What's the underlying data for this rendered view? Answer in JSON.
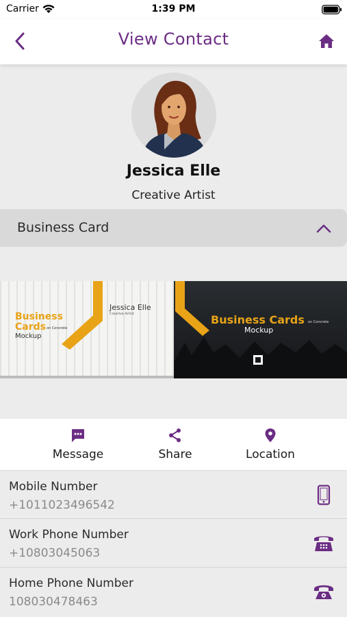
{
  "status_bar": {
    "carrier": "Carrier",
    "time": "1:39 PM"
  },
  "nav": {
    "title": "View Contact"
  },
  "contact": {
    "name": "Jessica Elle",
    "title": "Creative Artist"
  },
  "business_card_section": {
    "label": "Business Card",
    "expanded": true,
    "card_front": {
      "title_line1": "Business",
      "title_line2": "Cards",
      "small_caption": "on Concrete",
      "subtitle": "Mockup",
      "name": "Jessica Elle",
      "role": "Creative Artist"
    },
    "card_back": {
      "title": "Business Cards",
      "small_caption": "on Concrete",
      "subtitle": "Mockup"
    }
  },
  "actions": [
    {
      "label": "Message",
      "icon": "message-icon"
    },
    {
      "label": "Share",
      "icon": "share-icon"
    },
    {
      "label": "Location",
      "icon": "location-pin-icon"
    }
  ],
  "details": [
    {
      "label": "Mobile Number",
      "value": "+1011023496542",
      "icon": "mobile-phone-icon"
    },
    {
      "label": "Work Phone Number",
      "value": "+10803045063",
      "icon": "desk-phone-icon"
    },
    {
      "label": "Home Phone Number",
      "value": "108030478463",
      "icon": "telephone-icon"
    }
  ],
  "colors": {
    "accent": "#6b2d83",
    "card_orange": "#e8a317",
    "header_gray": "#d9d9d9",
    "background": "#ececec"
  }
}
